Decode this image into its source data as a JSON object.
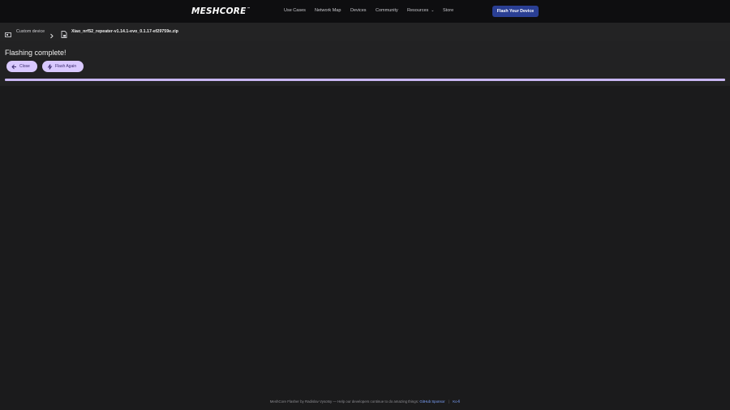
{
  "header": {
    "logo_text": "MESHCORE",
    "logo_mark": "™",
    "nav": [
      {
        "label": "Use Cases"
      },
      {
        "label": "Network Map"
      },
      {
        "label": "Devices"
      },
      {
        "label": "Community"
      },
      {
        "label": "Resources"
      },
      {
        "label": "Store"
      }
    ],
    "cta_label": "Flash Your Device"
  },
  "breadcrumb": {
    "device_label": "Custom device",
    "file_label": "Xiao_nrf52_repeater-v1.14.1-evo_0.1.17-ef29759e.zip"
  },
  "main": {
    "status_title": "Flashing complete!",
    "close_label": "Close",
    "flash_again_label": "Flash Again",
    "progress_fraction": 1.0
  },
  "footer": {
    "text": "MeshCore Flasher by Radislav Vysotsy — Help our developers continue to do amazing things:",
    "link_sponsor": "GitHub Sponsor",
    "separator": "|",
    "link_kofi": "Ko-fi"
  },
  "colors": {
    "accent_button": "#2a3f94",
    "pill_bg": "#d9c9ff",
    "progress": "#c8b6f2",
    "link": "#7ea4ff"
  }
}
